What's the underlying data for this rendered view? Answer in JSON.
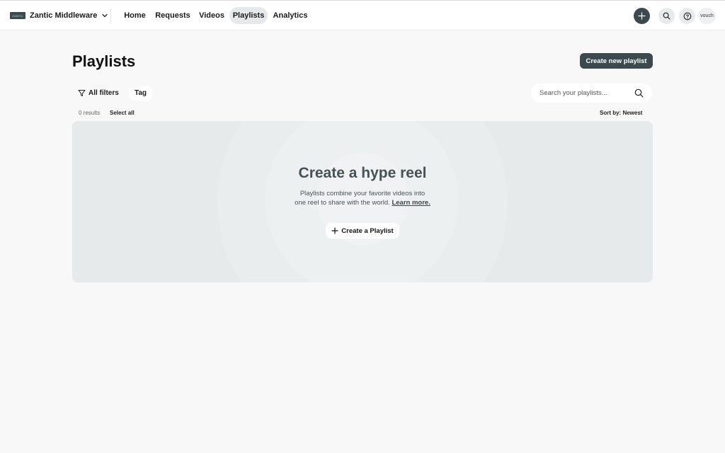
{
  "header": {
    "brand": {
      "logo_text": "ZANTIC",
      "name": "Zantic Middleware"
    },
    "nav": [
      {
        "label": "Home"
      },
      {
        "label": "Requests"
      },
      {
        "label": "Videos"
      },
      {
        "label": "Playlists",
        "active": true
      },
      {
        "label": "Analytics"
      }
    ],
    "avatar_label": "vouch",
    "icons": [
      "plus-icon",
      "search-icon",
      "help-icon",
      "chevron-down-icon"
    ]
  },
  "page": {
    "title": "Playlists",
    "create_button": "Create new playlist"
  },
  "filters": {
    "all_label": "All filters",
    "tag_label": "Tag"
  },
  "search": {
    "placeholder": "Search your playlists..."
  },
  "results": {
    "count_label": "0 results",
    "select_all": "Select all",
    "sort_label": "Sort by: Newest"
  },
  "empty_state": {
    "title": "Create a hype reel",
    "desc_line1": "Playlists combine your favorite videos into",
    "desc_line2": "one reel to share with the world.",
    "learn_more": "Learn more.",
    "button": "Create a Playlist"
  },
  "colors": {
    "accent": "#3a4a4f",
    "panel": "#e6eaeb",
    "background": "#f8f8f8"
  }
}
